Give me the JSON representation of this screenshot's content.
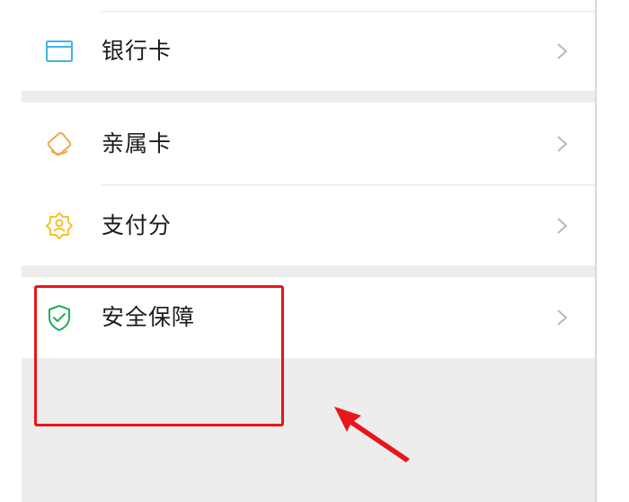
{
  "menu": {
    "groups": [
      {
        "items": [
          {
            "label": "银行卡",
            "icon": "bank-card-icon"
          }
        ]
      },
      {
        "items": [
          {
            "label": "亲属卡",
            "icon": "family-card-icon"
          },
          {
            "label": "支付分",
            "icon": "payscore-icon"
          }
        ]
      },
      {
        "items": [
          {
            "label": "安全保障",
            "icon": "security-shield-icon"
          }
        ]
      }
    ]
  },
  "colors": {
    "bank_icon": "#3fb4e6",
    "family_icon": "#f0a64a",
    "payscore_icon": "#f2c233",
    "shield_icon": "#1fae5c",
    "highlight": "#e8161b",
    "chevron": "#b8b8b8"
  }
}
